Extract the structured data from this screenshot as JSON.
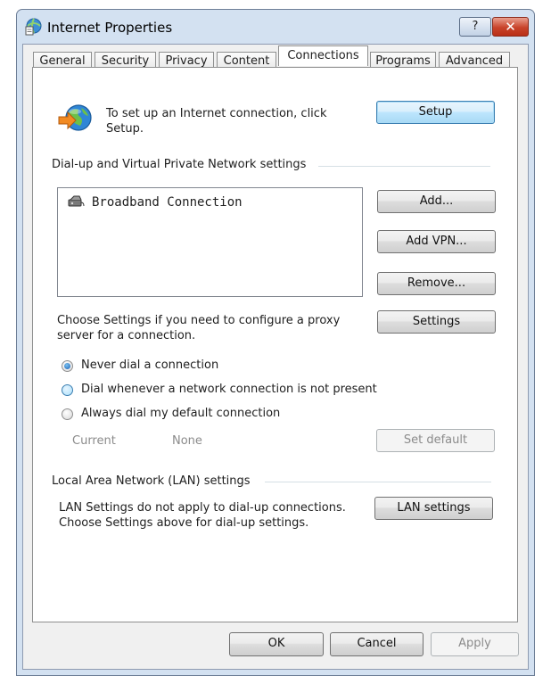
{
  "window": {
    "title": "Internet Properties",
    "help_glyph": "?",
    "close_glyph": "✕",
    "icon": "globe-document-icon"
  },
  "tabs": [
    {
      "label": "General"
    },
    {
      "label": "Security"
    },
    {
      "label": "Privacy"
    },
    {
      "label": "Content"
    },
    {
      "label": "Connections",
      "active": true
    },
    {
      "label": "Programs"
    },
    {
      "label": "Advanced"
    }
  ],
  "setup": {
    "text": "To set up an Internet connection, click Setup.",
    "button": "Setup",
    "icon": "globe-arrow-icon"
  },
  "dialup": {
    "group_label": "Dial-up and Virtual Private Network settings",
    "connections": [
      "Broadband Connection"
    ],
    "add": "Add...",
    "add_vpn": "Add VPN...",
    "remove": "Remove...",
    "proxy_text": "Choose Settings if you need to configure a proxy server for a connection.",
    "settings": "Settings",
    "radio_options": [
      {
        "label": "Never dial a connection",
        "checked": true
      },
      {
        "label": "Dial whenever a network connection is not present",
        "checked": false
      },
      {
        "label": "Always dial my default connection",
        "checked": false
      }
    ],
    "current_label": "Current",
    "current_value": "None",
    "set_default": "Set default"
  },
  "lan": {
    "group_label": "Local Area Network (LAN) settings",
    "text": "LAN Settings do not apply to dial-up connections. Choose Settings above for dial-up settings.",
    "button": "LAN settings"
  },
  "footer": {
    "ok": "OK",
    "cancel": "Cancel",
    "apply": "Apply"
  }
}
